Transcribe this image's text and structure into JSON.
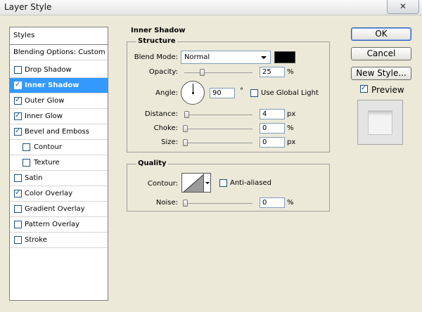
{
  "window": {
    "title": "Layer Style",
    "close_glyph": "✕"
  },
  "styles_panel": {
    "header": "Styles",
    "blending_options": "Blending Options: Custom",
    "items": [
      {
        "label": "Drop Shadow",
        "checked": false,
        "indent": false,
        "selected": false
      },
      {
        "label": "Inner Shadow",
        "checked": true,
        "indent": false,
        "selected": true
      },
      {
        "label": "Outer Glow",
        "checked": true,
        "indent": false,
        "selected": false
      },
      {
        "label": "Inner Glow",
        "checked": true,
        "indent": false,
        "selected": false
      },
      {
        "label": "Bevel and Emboss",
        "checked": true,
        "indent": false,
        "selected": false
      },
      {
        "label": "Contour",
        "checked": false,
        "indent": true,
        "selected": false
      },
      {
        "label": "Texture",
        "checked": false,
        "indent": true,
        "selected": false
      },
      {
        "label": "Satin",
        "checked": false,
        "indent": false,
        "selected": false
      },
      {
        "label": "Color Overlay",
        "checked": true,
        "indent": false,
        "selected": false
      },
      {
        "label": "Gradient Overlay",
        "checked": false,
        "indent": false,
        "selected": false
      },
      {
        "label": "Pattern Overlay",
        "checked": false,
        "indent": false,
        "selected": false
      },
      {
        "label": "Stroke",
        "checked": false,
        "indent": false,
        "selected": false
      }
    ]
  },
  "section": {
    "title": "Inner Shadow",
    "structure": {
      "title": "Structure",
      "blend_mode_label": "Blend Mode:",
      "blend_mode_value": "Normal",
      "shadow_color": "#000000",
      "opacity_label": "Opacity:",
      "opacity_value": "25",
      "opacity_unit": "%",
      "opacity_slider_pct": 25,
      "angle_label": "Angle:",
      "angle_value": "90",
      "angle_unit": "°",
      "use_global_light_label": "Use Global Light",
      "use_global_light_checked": false,
      "distance_label": "Distance:",
      "distance_value": "4",
      "distance_unit": "px",
      "distance_slider_pct": 2,
      "choke_label": "Choke:",
      "choke_value": "0",
      "choke_unit": "%",
      "choke_slider_pct": 0,
      "size_label": "Size:",
      "size_value": "0",
      "size_unit": "px",
      "size_slider_pct": 0
    },
    "quality": {
      "title": "Quality",
      "contour_label": "Contour:",
      "anti_aliased_label": "Anti-aliased",
      "anti_aliased_checked": false,
      "noise_label": "Noise:",
      "noise_value": "0",
      "noise_unit": "%",
      "noise_slider_pct": 0
    }
  },
  "buttons": {
    "ok": "OK",
    "cancel": "Cancel",
    "new_style": "New Style..."
  },
  "preview": {
    "label": "Preview",
    "checked": true
  }
}
